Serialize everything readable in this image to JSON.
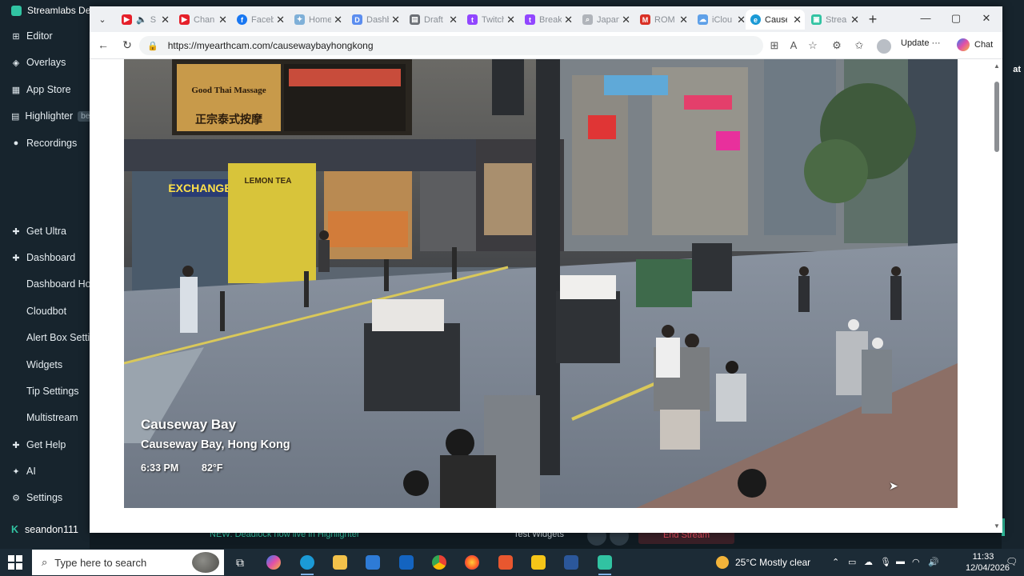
{
  "streamlabs": {
    "title": "Streamlabs De",
    "nav": [
      {
        "label": "Editor",
        "icon": "editor-icon"
      },
      {
        "label": "Overlays",
        "icon": "overlays-icon"
      },
      {
        "label": "App Store",
        "icon": "app-store-icon"
      },
      {
        "label": "Highlighter",
        "icon": "highlighter-icon",
        "badge": "be"
      },
      {
        "label": "Recordings",
        "icon": "recordings-icon"
      },
      {
        "label": "Get Ultra",
        "icon": "ultra-icon"
      },
      {
        "label": "Dashboard",
        "icon": "dashboard-icon"
      },
      {
        "label": "Dashboard Hon",
        "icon": ""
      },
      {
        "label": "Cloudbot",
        "icon": ""
      },
      {
        "label": "Alert Box Settin",
        "icon": ""
      },
      {
        "label": "Widgets",
        "icon": ""
      },
      {
        "label": "Tip Settings",
        "icon": ""
      },
      {
        "label": "Multistream",
        "icon": ""
      },
      {
        "label": "Get Help",
        "icon": "help-icon"
      },
      {
        "label": "AI",
        "icon": "ai-icon"
      },
      {
        "label": "Settings",
        "icon": "settings-icon"
      }
    ],
    "user": "seandon111",
    "right_fragment": "at",
    "bottom_news": "NEW: Deadlock now live in Highlighter",
    "bottom_test": "Test Widgets",
    "bottom_end": "End Stream"
  },
  "browser": {
    "tabs": [
      {
        "label": "S",
        "color": "#e5202a",
        "glyph": "▶"
      },
      {
        "label": "Chan",
        "color": "#e5202a",
        "glyph": "▶"
      },
      {
        "label": "Faceb",
        "color": "#1877f2",
        "glyph": "f"
      },
      {
        "label": "Home",
        "color": "#7fb0d8",
        "glyph": "✦"
      },
      {
        "label": "Dashb",
        "color": "#5b8def",
        "glyph": "D"
      },
      {
        "label": "Draft",
        "color": "#6b6f75",
        "glyph": "▤"
      },
      {
        "label": "Twitch",
        "color": "#9146ff",
        "glyph": "t"
      },
      {
        "label": "Break",
        "color": "#9146ff",
        "glyph": "t"
      },
      {
        "label": "Japan",
        "color": "#b0b4ba",
        "glyph": "⌕"
      },
      {
        "label": "ROM",
        "color": "#d93025",
        "glyph": "M"
      },
      {
        "label": "iClou",
        "color": "#5ea0e8",
        "glyph": "☁"
      },
      {
        "label": "Cause",
        "color": "#1b9ad6",
        "glyph": "e",
        "active": true
      },
      {
        "label": "Strea",
        "color": "#31c3a2",
        "glyph": "▣"
      }
    ],
    "url": "https://myearthcam.com/causewaybayhongkong",
    "update_label": "Update",
    "chat_label": "Chat"
  },
  "video": {
    "location_title": "Causeway Bay",
    "location_sub": "Causeway Bay, Hong Kong",
    "time": "6:33 PM",
    "temperature": "82°F",
    "signs": {
      "thai": "正宗泰式按摩",
      "thai_en": "Good Thai Massage",
      "exchange": "EXCHANGE",
      "lemon": "LEMON TEA"
    }
  },
  "taskbar": {
    "search_placeholder": "Type here to search",
    "weather": "25°C  Mostly clear",
    "time": "11:33",
    "date": "12/04/2026"
  }
}
